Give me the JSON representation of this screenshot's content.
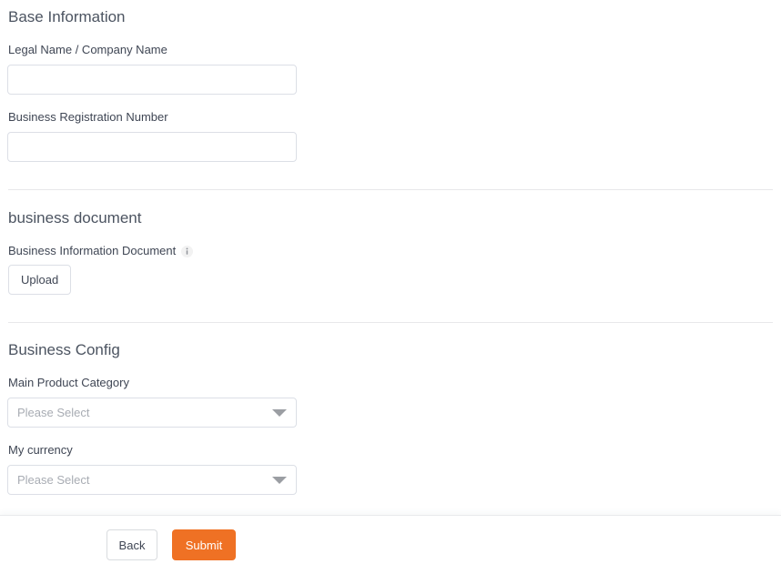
{
  "sections": [
    {
      "title": "Base Information",
      "fields": [
        {
          "label": "Legal Name / Company Name",
          "value": "",
          "placeholder": ""
        },
        {
          "label": "Business Registration Number",
          "value": "",
          "placeholder": ""
        }
      ]
    },
    {
      "title": "business document",
      "document_label": "Business Information Document",
      "info_icon": "info-circle-icon",
      "upload_label": "Upload"
    },
    {
      "title": "Business Config",
      "selects": [
        {
          "label": "Main Product Category",
          "value": "Please Select"
        },
        {
          "label": "My currency",
          "value": "Please Select"
        }
      ]
    }
  ],
  "footer": {
    "back_label": "Back",
    "submit_label": "Submit",
    "submit_color": "#ef7124"
  }
}
